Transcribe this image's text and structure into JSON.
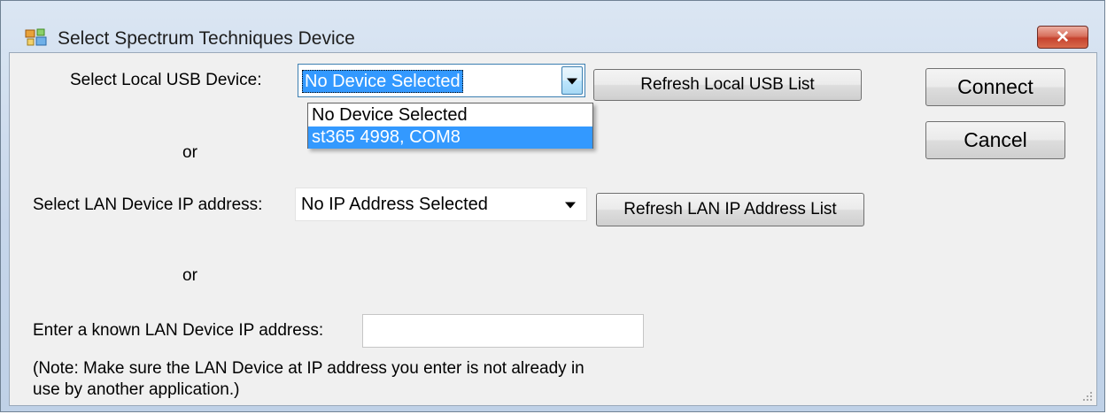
{
  "window": {
    "title": "Select Spectrum Techniques Device",
    "close_glyph": "✕"
  },
  "usb": {
    "label": "Select Local USB Device:",
    "selected": "No Device Selected",
    "options": [
      "No Device Selected",
      "st365 4998, COM8"
    ],
    "highlighted_index": 1,
    "refresh_label": "Refresh Local USB List"
  },
  "or1": "or",
  "lan": {
    "label": "Select LAN Device IP address:",
    "selected": "No IP Address Selected",
    "refresh_label": "Refresh LAN IP Address List"
  },
  "or2": "or",
  "manual": {
    "label": "Enter a known LAN Device IP address:",
    "value": "",
    "note_line1": "(Note: Make sure the LAN Device at IP address you enter is not already in",
    "note_line2": "use by another application.)"
  },
  "actions": {
    "connect_label": "Connect",
    "cancel_label": "Cancel"
  },
  "icons": {
    "app": "app-window-icon",
    "dropdown": "chevron-down-icon",
    "close": "close-icon",
    "grip": "resize-grip-icon"
  },
  "colors": {
    "selection": "#3399ff",
    "close_button": "#c6432f",
    "client_bg": "#f0f0f0"
  }
}
